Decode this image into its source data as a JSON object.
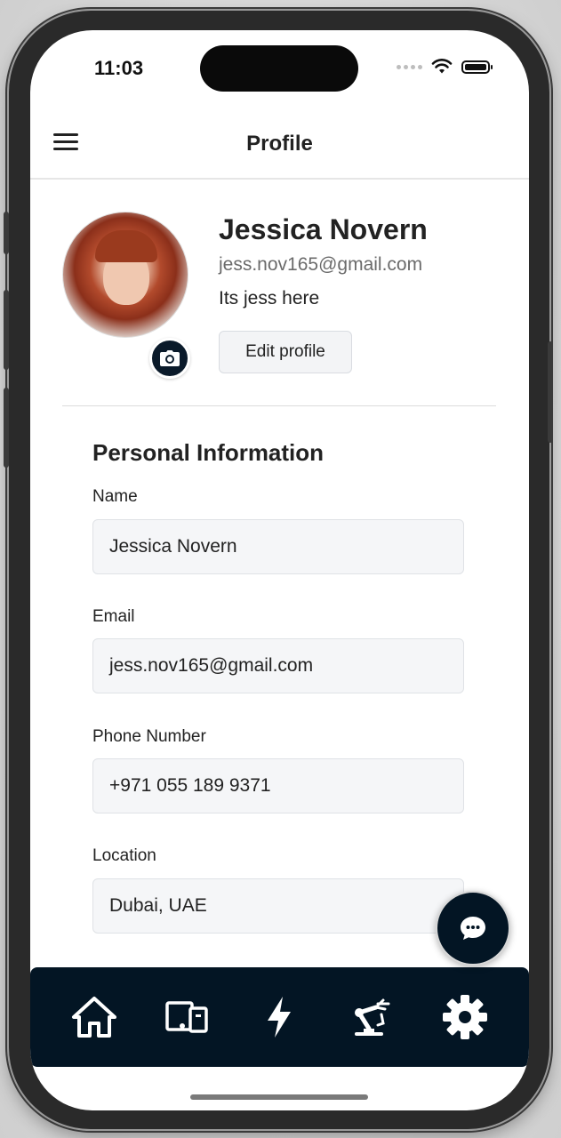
{
  "status_bar": {
    "time": "11:03"
  },
  "header": {
    "title": "Profile"
  },
  "profile": {
    "name": "Jessica Novern",
    "email": "jess.nov165@gmail.com",
    "bio": "Its jess here",
    "edit_button": "Edit profile"
  },
  "personal_info": {
    "title": "Personal Information",
    "fields": [
      {
        "label": "Name",
        "value": "Jessica Novern"
      },
      {
        "label": "Email",
        "value": "jess.nov165@gmail.com"
      },
      {
        "label": "Phone Number",
        "value": "+971 055 189 9371"
      },
      {
        "label": "Location",
        "value": "Dubai, UAE"
      }
    ]
  },
  "tabs": [
    {
      "icon": "home-icon"
    },
    {
      "icon": "devices-icon"
    },
    {
      "icon": "lightning-icon"
    },
    {
      "icon": "robot-arm-icon"
    },
    {
      "icon": "gear-icon"
    }
  ],
  "fab": {
    "icon": "chat-icon"
  },
  "colors": {
    "navy": "#031524",
    "text": "#222222",
    "muted": "#6b6b6b",
    "input_bg": "#f5f6f8"
  }
}
